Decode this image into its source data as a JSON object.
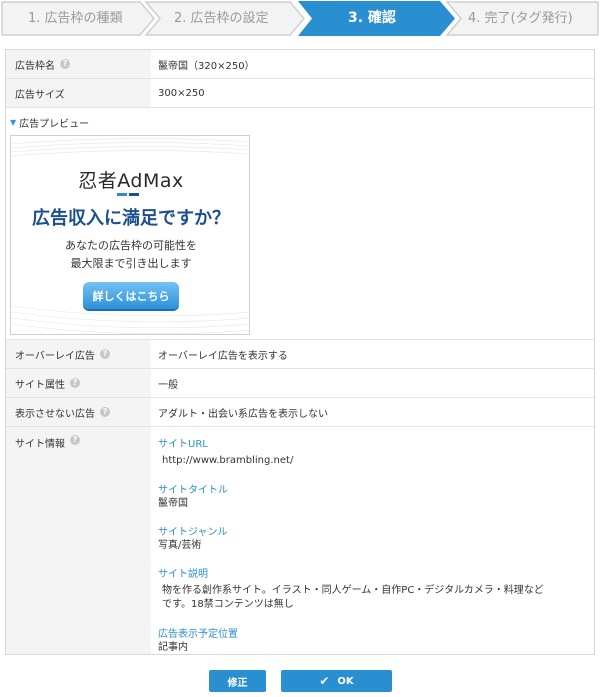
{
  "steps": [
    {
      "label": "1. 広告枠の種類",
      "state": "done"
    },
    {
      "label": "2. 広告枠の設定",
      "state": "done"
    },
    {
      "label": "3. 確認",
      "state": "active"
    },
    {
      "label": "4. 完了(タグ発行)",
      "state": "upcoming"
    }
  ],
  "colors": {
    "active_step": "#2a8fd0",
    "link": "#2a8fd0",
    "button": "#2a8fd0",
    "label_bg": "#f4f4f4"
  },
  "rows": {
    "ad_frame_name": {
      "label": "広告枠名",
      "value": "鬣帝国（320×250）"
    },
    "ad_size": {
      "label": "広告サイズ",
      "value": "300×250"
    },
    "ad_preview": {
      "label": "広告プレビュー"
    },
    "overlay": {
      "label": "オーバーレイ広告",
      "value": "オーバーレイ広告を表示する"
    },
    "site_attribute": {
      "label": "サイト属性",
      "value": "一般"
    },
    "hidden_ads": {
      "label": "表示させない広告",
      "value": "アダルト・出会い系広告を表示しない"
    },
    "site_info": {
      "label": "サイト情報"
    }
  },
  "banner": {
    "logo": "忍者AdMax",
    "headline": "広告収入に満足ですか？",
    "sub_line1": "あなたの広告枠の可能性を",
    "sub_line2": "最大限まで引き出します",
    "cta": "詳しくはこちら"
  },
  "site_info": [
    {
      "heading": "サイトURL",
      "value": "http://www.brambling.net/"
    },
    {
      "heading": "サイトタイトル",
      "value": "鬣帝国"
    },
    {
      "heading": "サイトジャンル",
      "value": "写真/芸術"
    },
    {
      "heading": "サイト説明",
      "value": "物を作る創作系サイト。イラスト・同人ゲーム・自作PC・デジタルカメラ・料理などです。18禁コンテンツは無し"
    },
    {
      "heading": "広告表示予定位置",
      "value": "記事内"
    }
  ],
  "buttons": {
    "back": "修正",
    "ok": "OK"
  }
}
